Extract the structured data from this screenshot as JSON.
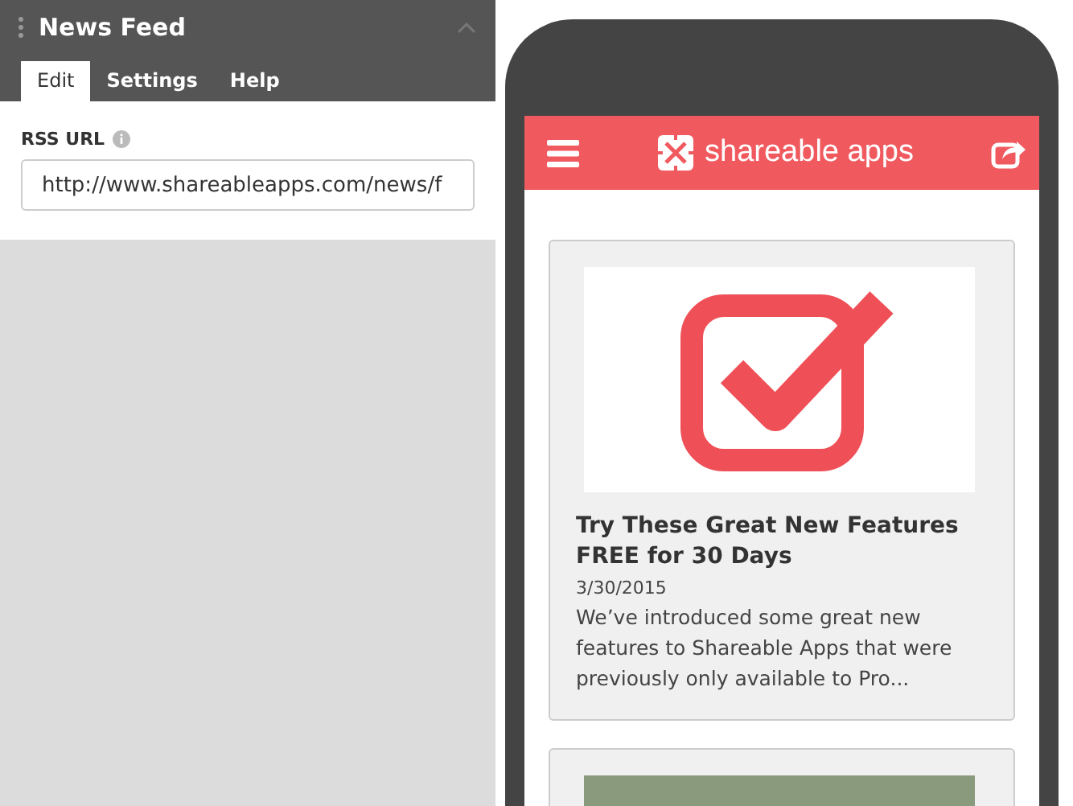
{
  "panel": {
    "title": "News Feed",
    "expanded": true,
    "tabs": [
      {
        "label": "Edit",
        "selected": true
      },
      {
        "label": "Settings",
        "selected": false
      },
      {
        "label": "Help",
        "selected": false
      }
    ],
    "field": {
      "label": "RSS URL",
      "value": "http://www.shareableapps.com/news/f"
    }
  },
  "app": {
    "brand": "shareable apps",
    "posts": [
      {
        "kind": "checkmark",
        "title": "Try These Great New Features FREE for 30 Days",
        "date": "3/30/2015",
        "excerpt": "We’ve introduced some great new features to Shareable Apps that were previously only available to Pro..."
      },
      {
        "kind": "photo"
      }
    ]
  }
}
